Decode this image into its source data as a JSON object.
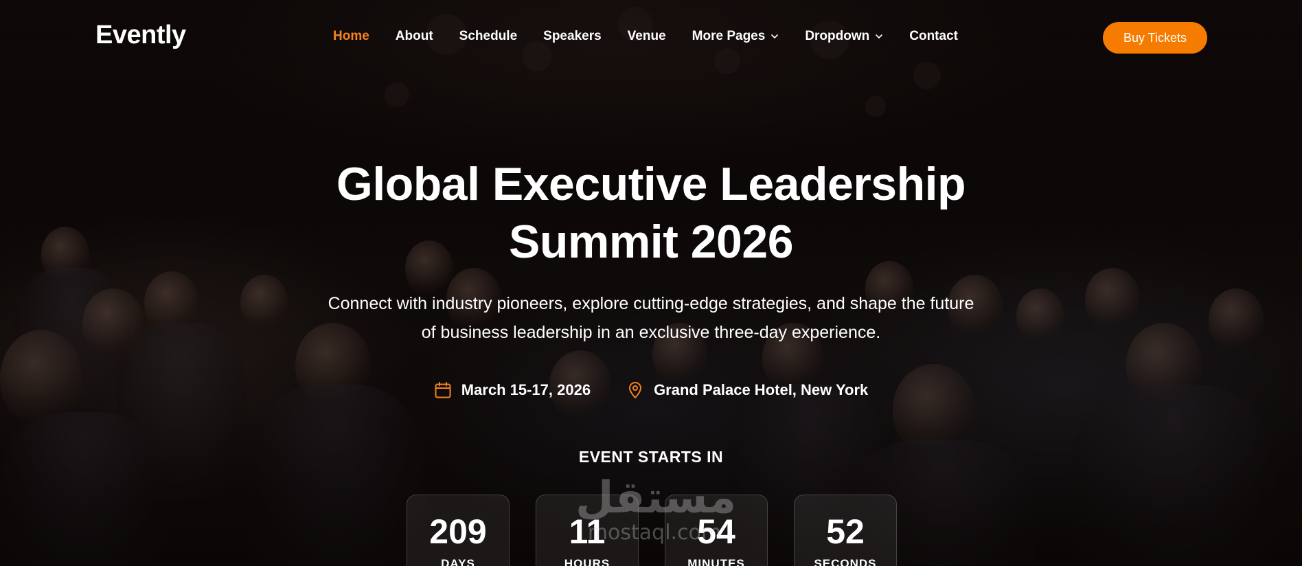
{
  "header": {
    "logo": "Evently",
    "nav": [
      {
        "label": "Home",
        "active": true
      },
      {
        "label": "About"
      },
      {
        "label": "Schedule"
      },
      {
        "label": "Speakers"
      },
      {
        "label": "Venue"
      },
      {
        "label": "More Pages",
        "has_dropdown": true
      },
      {
        "label": "Dropdown",
        "has_dropdown": true
      },
      {
        "label": "Contact"
      }
    ],
    "cta_label": "Buy Tickets"
  },
  "hero": {
    "title_line1": "Global Executive Leadership",
    "title_line2": "Summit 2026",
    "subtitle_line1": "Connect with industry pioneers, explore cutting-edge strategies, and shape the future",
    "subtitle_line2": "of business leadership in an exclusive three-day experience.",
    "date": "March 15-17, 2026",
    "date_icon": "calendar-icon",
    "location": "Grand Palace Hotel, New York",
    "location_icon": "map-pin-icon"
  },
  "countdown": {
    "label": "EVENT STARTS IN",
    "units": [
      {
        "value": "209",
        "unit": "DAYS"
      },
      {
        "value": "11",
        "unit": "HOURS"
      },
      {
        "value": "54",
        "unit": "MINUTES"
      },
      {
        "value": "52",
        "unit": "SECONDS"
      }
    ]
  },
  "watermark": {
    "arabic": "مستقل",
    "latin": "mostaql.com"
  },
  "colors": {
    "accent": "#f57c00",
    "active_nav": "#f58220",
    "text": "#ffffff",
    "background": "#0b0706"
  }
}
